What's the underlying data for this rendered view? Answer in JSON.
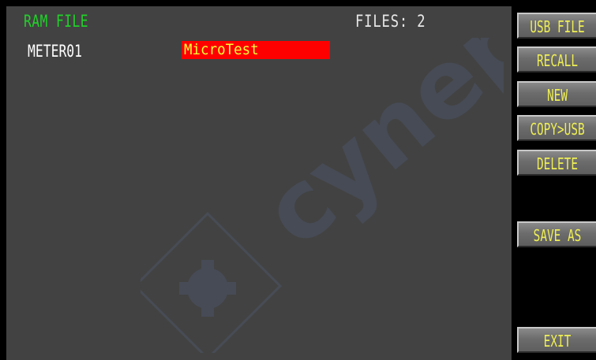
{
  "header": {
    "title": "RAM FILE",
    "files_count": "FILES: 2"
  },
  "files": [
    {
      "name": "METER01",
      "description": "MicroTest"
    }
  ],
  "softkeys": [
    {
      "label": "USB FILE"
    },
    {
      "label": "RECALL"
    },
    {
      "label": "NEW"
    },
    {
      "label": "COPY>USB"
    },
    {
      "label": "DELETE"
    },
    {
      "label": "SAVE AS"
    },
    {
      "label": "EXIT"
    }
  ],
  "watermark": {
    "text": "cynepom"
  },
  "colors": {
    "title": "#22d02a",
    "softkey_text": "#eeee55",
    "selection_bg": "#ff0000",
    "selection_text": "#ffff33",
    "screen_bg": "#424242"
  }
}
